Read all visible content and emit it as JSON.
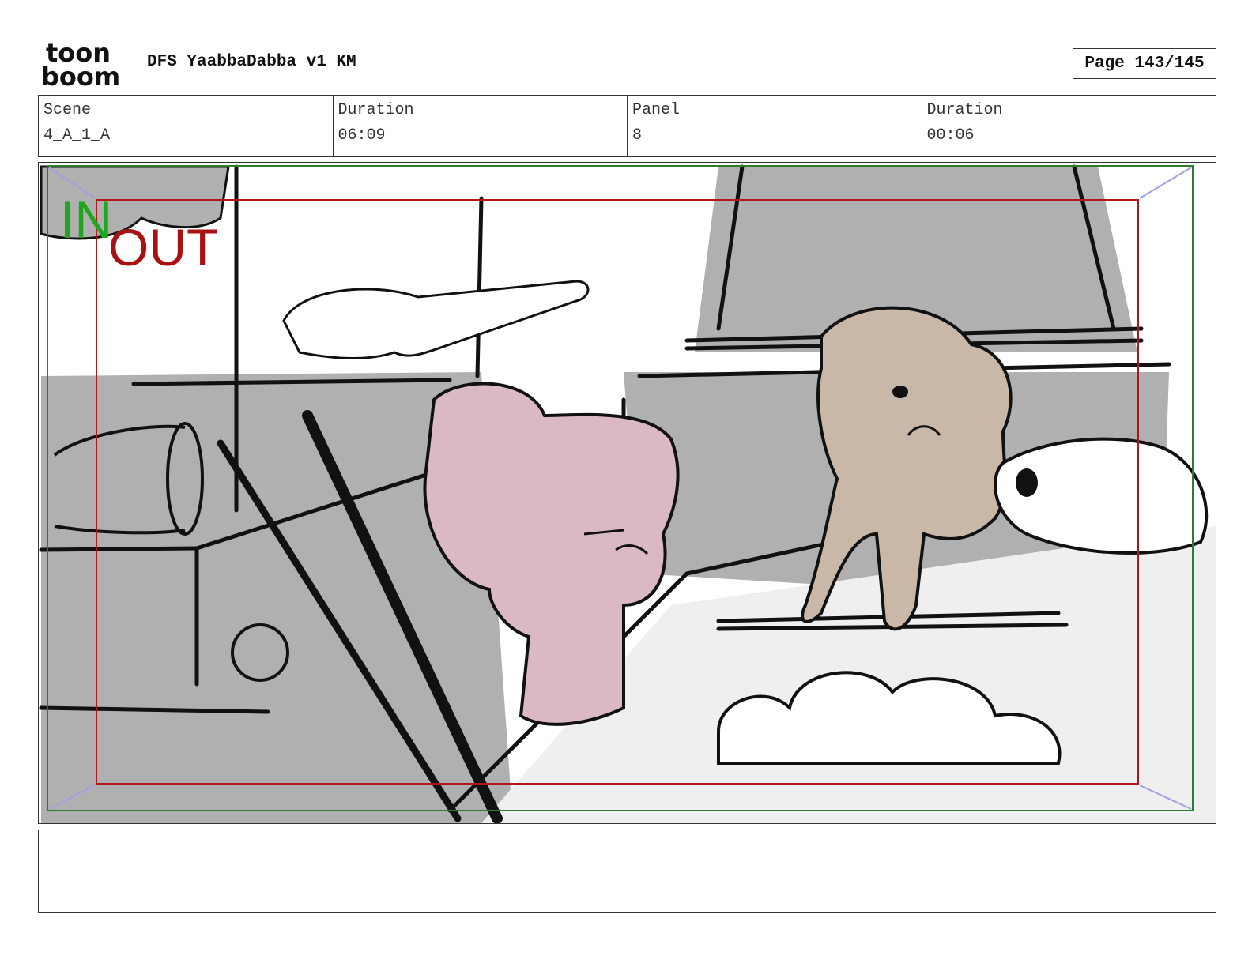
{
  "logo": {
    "icon": "toon-boom-logo",
    "line1": "toon",
    "line2": "boom"
  },
  "header": {
    "project_title": "DFS YaabbaDabba v1 KM",
    "page_indicator": "Page 143/145"
  },
  "info": {
    "scene_label": "Scene",
    "scene_value": "4_A_1_A",
    "scene_duration_label": "Duration",
    "scene_duration_value": "06:09",
    "panel_label": "Panel",
    "panel_value": "8",
    "panel_duration_label": "Duration",
    "panel_duration_value": "00:06"
  },
  "panel": {
    "in_label": "IN",
    "out_label": "OUT",
    "colors": {
      "in_frame": "#2e7d2e",
      "out_frame": "#b01818",
      "in_text": "#1fa51f",
      "out_text": "#a81212",
      "shadow_fill": "#b0b0b0",
      "light_fill": "#efefef",
      "pink_character": "#dab8c6",
      "tan_character": "#c9b7a8",
      "corner_arrows": "#a0a0e0"
    }
  },
  "notes": {
    "text": ""
  }
}
